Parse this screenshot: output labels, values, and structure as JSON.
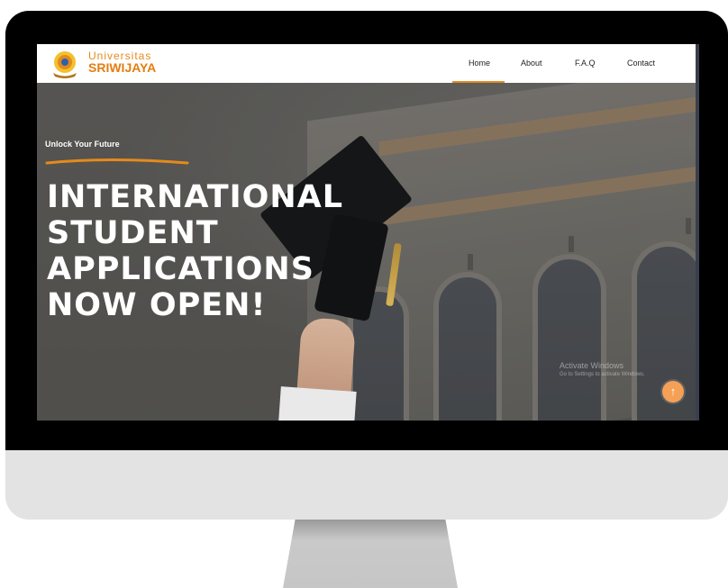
{
  "brand": {
    "line1": "Universitas",
    "line2": "SRIWIJAYA",
    "accent_color": "#e58a1c"
  },
  "nav": {
    "items": [
      "Home",
      "About",
      "F.A.Q",
      "Contact"
    ],
    "active": "Home"
  },
  "hero": {
    "eyebrow": "Unlock Your Future",
    "headline_lines": [
      "INTERNATIONAL",
      "STUDENT",
      "APPLICATIONS",
      "NOW OPEN!"
    ]
  },
  "watermark": {
    "title": "Activate Windows",
    "subtitle": "Go to Settings to activate Windows."
  },
  "scroll_top": {
    "icon": "arrow-up-icon",
    "glyph": "↑"
  }
}
